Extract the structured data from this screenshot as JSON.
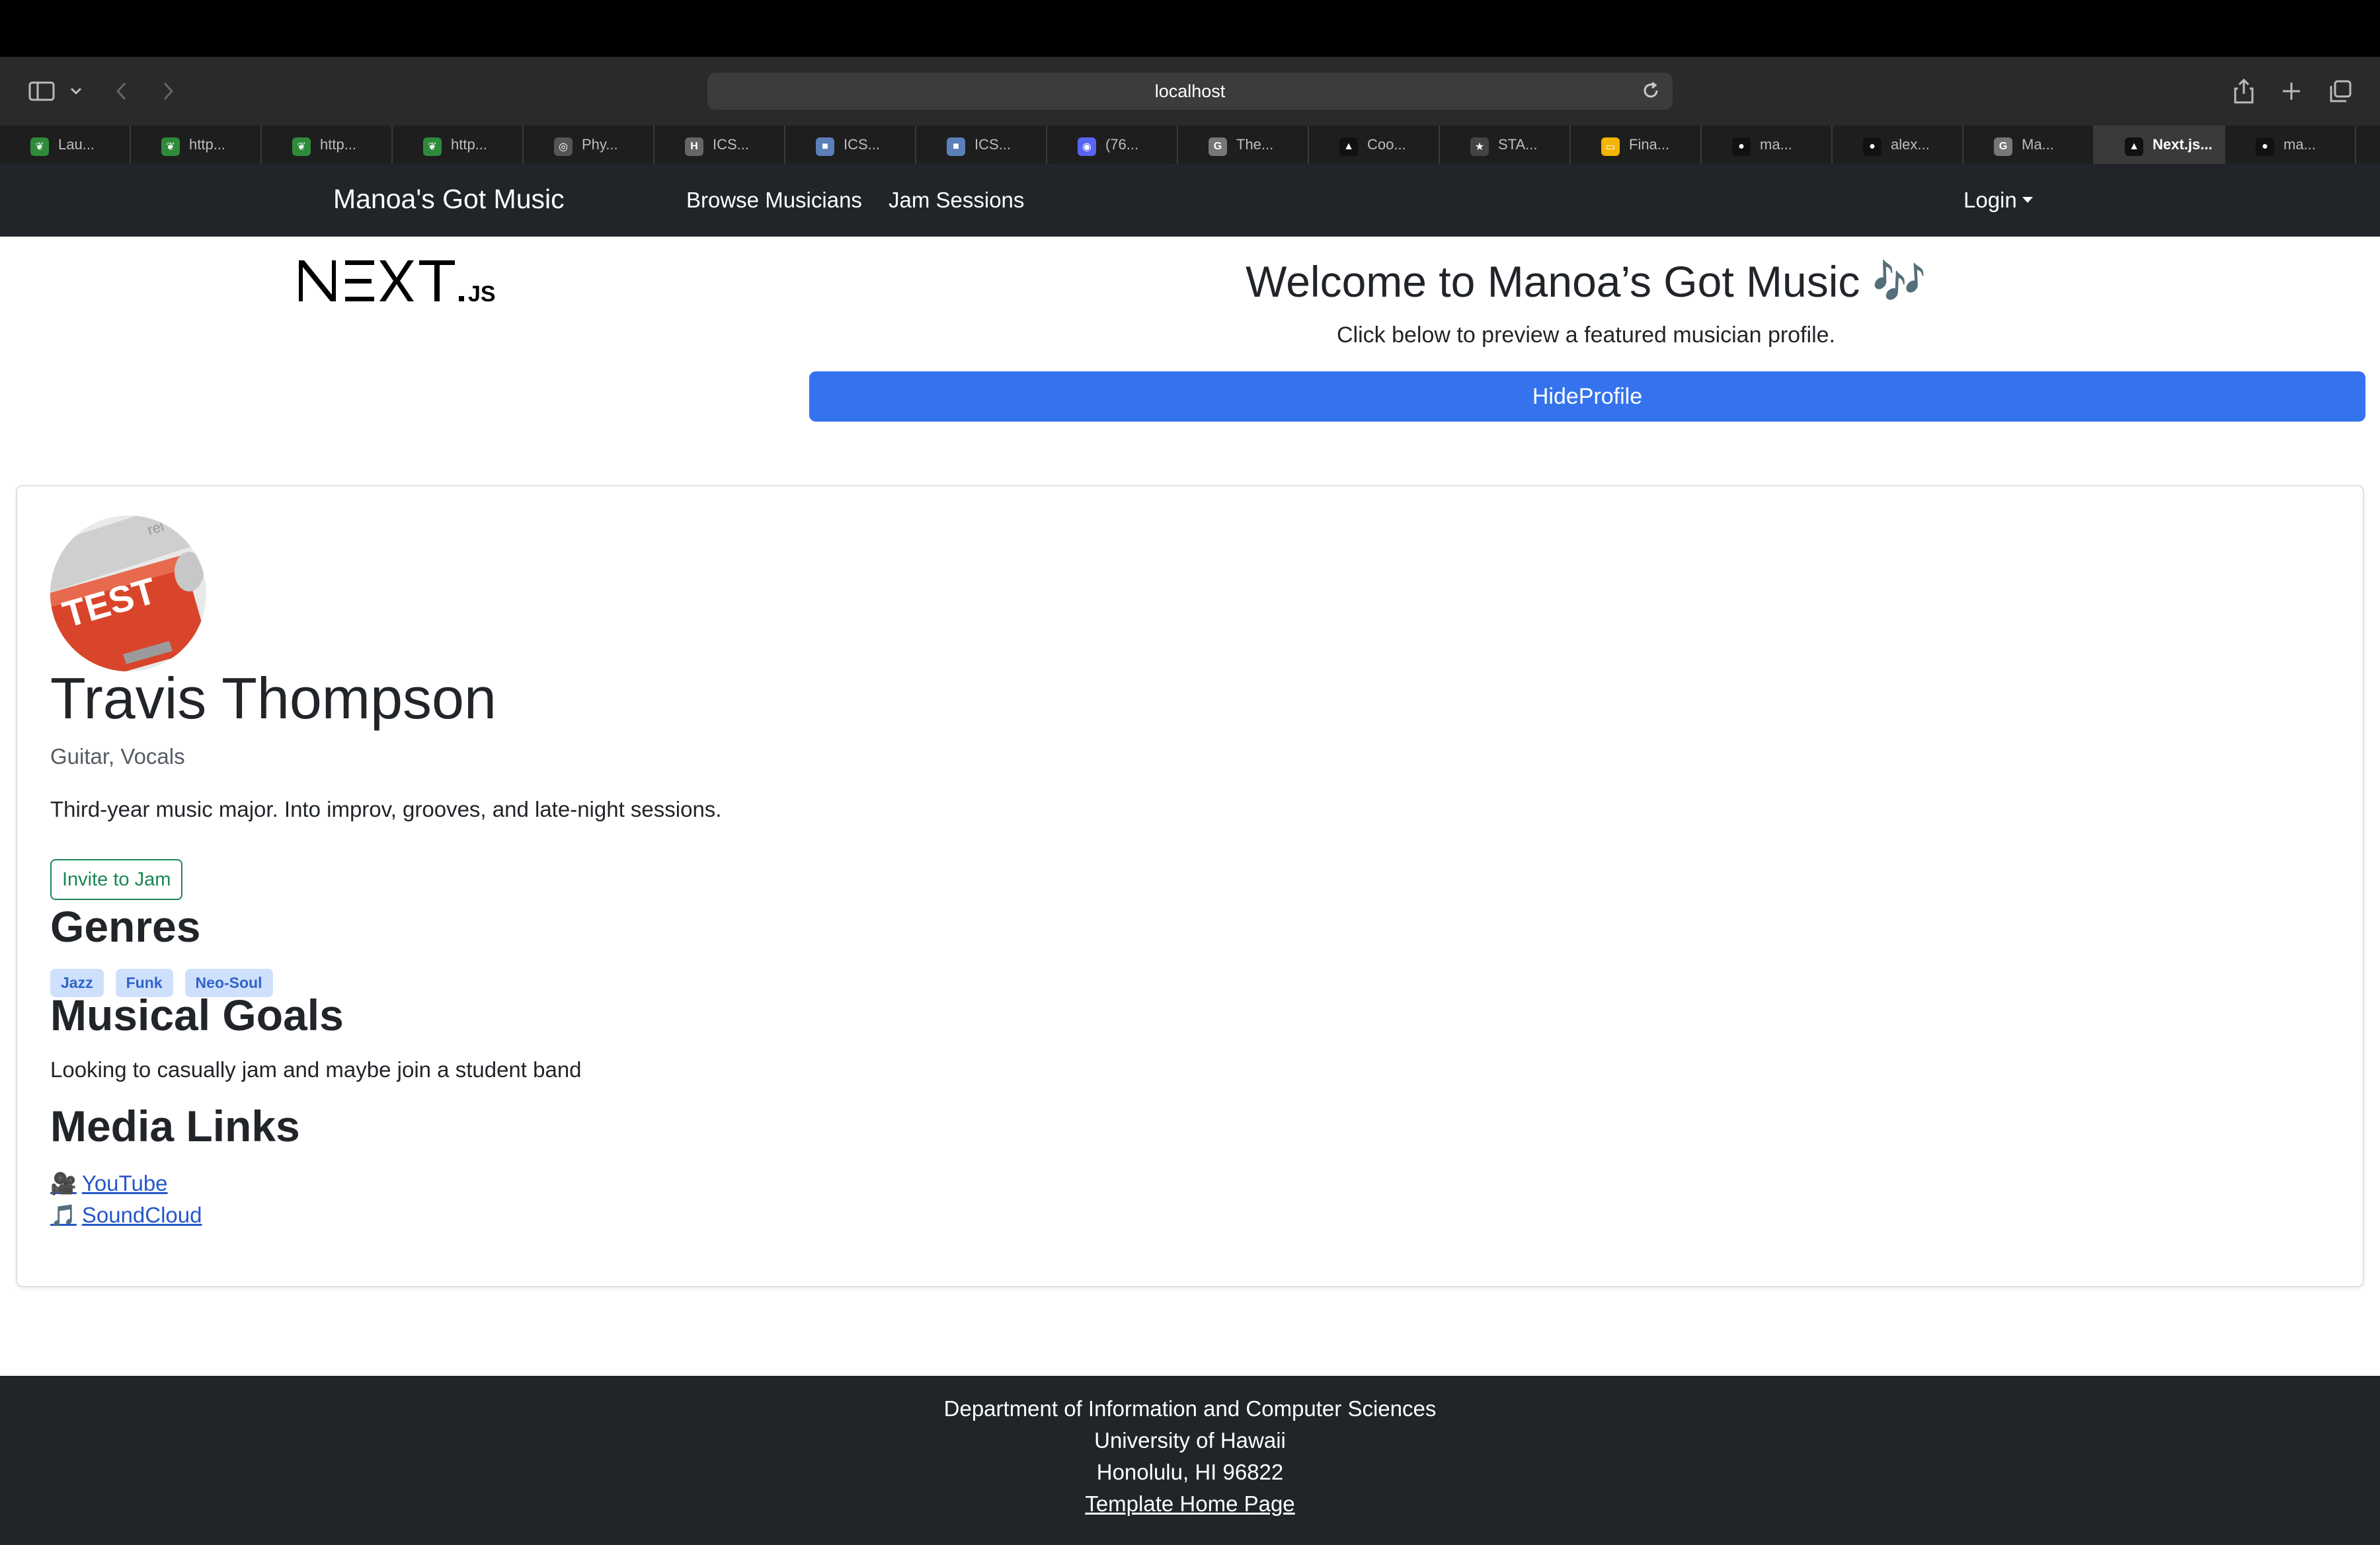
{
  "browser": {
    "url": "localhost",
    "tabs": [
      {
        "label": "Lau...",
        "favicon": "leaf-icon",
        "color": "#2e8b3a"
      },
      {
        "label": "http...",
        "favicon": "leaf-icon",
        "color": "#2e8b3a"
      },
      {
        "label": "http...",
        "favicon": "leaf-icon",
        "color": "#2e8b3a"
      },
      {
        "label": "http...",
        "favicon": "leaf-icon",
        "color": "#2e8b3a"
      },
      {
        "label": "Phy...",
        "favicon": "target-icon",
        "color": "#555"
      },
      {
        "label": "ICS...",
        "favicon": "h-icon",
        "color": "#666"
      },
      {
        "label": "ICS...",
        "favicon": "square-icon",
        "color": "#5b7fb8"
      },
      {
        "label": "ICS...",
        "favicon": "square-icon",
        "color": "#5b7fb8"
      },
      {
        "label": "(76...",
        "favicon": "discord-icon",
        "color": "#5865f2"
      },
      {
        "label": "The...",
        "favicon": "g-icon",
        "color": "#777"
      },
      {
        "label": "Coo...",
        "favicon": "triangle-icon",
        "color": "#111"
      },
      {
        "label": "STA...",
        "favicon": "star-icon",
        "color": "#444"
      },
      {
        "label": "Fina...",
        "favicon": "slides-icon",
        "color": "#f4b400"
      },
      {
        "label": "ma...",
        "favicon": "github-icon",
        "color": "#111"
      },
      {
        "label": "alex...",
        "favicon": "github-icon",
        "color": "#111"
      },
      {
        "label": "Ma...",
        "favicon": "g-icon",
        "color": "#777"
      },
      {
        "label": "Next.js...",
        "favicon": "triangle-icon",
        "color": "#111",
        "active": true
      },
      {
        "label": "ma...",
        "favicon": "github-icon",
        "color": "#111"
      }
    ]
  },
  "navbar": {
    "brand": "Manoa's Got Music",
    "links": [
      "Browse Musicians",
      "Jam Sessions"
    ],
    "login": "Login"
  },
  "hero": {
    "title": "Welcome to Manoa’s Got Music 🎶",
    "subtitle": "Click below to preview a featured musician profile.",
    "button": "HideProfile"
  },
  "profile": {
    "avatar_text": "TEST",
    "name": "Travis Thompson",
    "instruments": "Guitar, Vocals",
    "bio": "Third-year music major. Into improv, grooves, and late-night sessions.",
    "invite_label": "Invite to Jam",
    "genres_heading": "Genres",
    "genres": [
      "Jazz",
      "Funk",
      "Neo-Soul"
    ],
    "goals_heading": "Musical Goals",
    "goals": "Looking to casually jam and maybe join a student band",
    "media_heading": "Media Links",
    "media": [
      {
        "icon": "🎥",
        "label": "YouTube"
      },
      {
        "icon": "🎵",
        "label": "SoundCloud"
      }
    ]
  },
  "footer": {
    "line1": "Department of Information and Computer Sciences",
    "line2": "University of Hawaii",
    "line3": "Honolulu, HI 96822",
    "link": "Template Home Page"
  },
  "colors": {
    "primary": "#3573ee",
    "navbar": "#212529",
    "success": "#198754",
    "badge_bg": "#cfe0fd"
  }
}
